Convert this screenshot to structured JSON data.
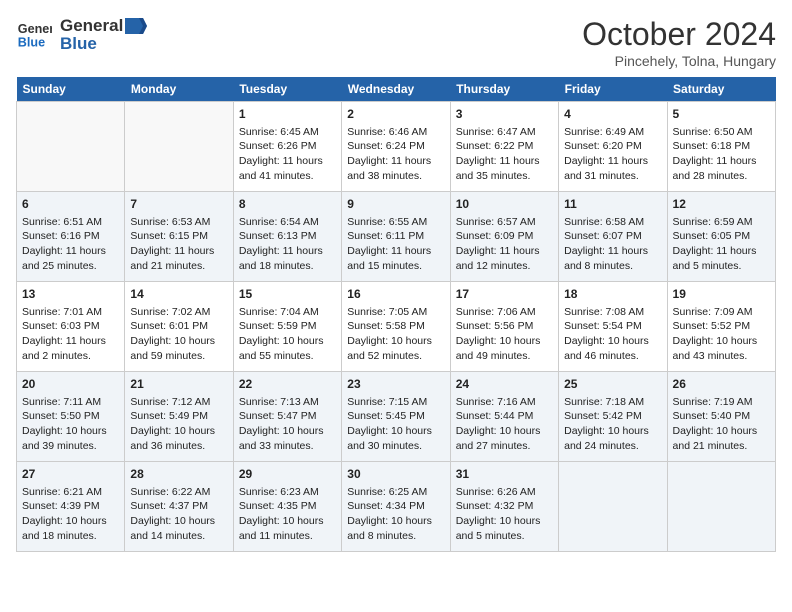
{
  "header": {
    "logo_line1": "General",
    "logo_line2": "Blue",
    "month_title": "October 2024",
    "subtitle": "Pincehely, Tolna, Hungary"
  },
  "weekdays": [
    "Sunday",
    "Monday",
    "Tuesday",
    "Wednesday",
    "Thursday",
    "Friday",
    "Saturday"
  ],
  "weeks": [
    [
      {
        "day": "",
        "content": ""
      },
      {
        "day": "",
        "content": ""
      },
      {
        "day": "1",
        "content": "Sunrise: 6:45 AM\nSunset: 6:26 PM\nDaylight: 11 hours and 41 minutes."
      },
      {
        "day": "2",
        "content": "Sunrise: 6:46 AM\nSunset: 6:24 PM\nDaylight: 11 hours and 38 minutes."
      },
      {
        "day": "3",
        "content": "Sunrise: 6:47 AM\nSunset: 6:22 PM\nDaylight: 11 hours and 35 minutes."
      },
      {
        "day": "4",
        "content": "Sunrise: 6:49 AM\nSunset: 6:20 PM\nDaylight: 11 hours and 31 minutes."
      },
      {
        "day": "5",
        "content": "Sunrise: 6:50 AM\nSunset: 6:18 PM\nDaylight: 11 hours and 28 minutes."
      }
    ],
    [
      {
        "day": "6",
        "content": "Sunrise: 6:51 AM\nSunset: 6:16 PM\nDaylight: 11 hours and 25 minutes."
      },
      {
        "day": "7",
        "content": "Sunrise: 6:53 AM\nSunset: 6:15 PM\nDaylight: 11 hours and 21 minutes."
      },
      {
        "day": "8",
        "content": "Sunrise: 6:54 AM\nSunset: 6:13 PM\nDaylight: 11 hours and 18 minutes."
      },
      {
        "day": "9",
        "content": "Sunrise: 6:55 AM\nSunset: 6:11 PM\nDaylight: 11 hours and 15 minutes."
      },
      {
        "day": "10",
        "content": "Sunrise: 6:57 AM\nSunset: 6:09 PM\nDaylight: 11 hours and 12 minutes."
      },
      {
        "day": "11",
        "content": "Sunrise: 6:58 AM\nSunset: 6:07 PM\nDaylight: 11 hours and 8 minutes."
      },
      {
        "day": "12",
        "content": "Sunrise: 6:59 AM\nSunset: 6:05 PM\nDaylight: 11 hours and 5 minutes."
      }
    ],
    [
      {
        "day": "13",
        "content": "Sunrise: 7:01 AM\nSunset: 6:03 PM\nDaylight: 11 hours and 2 minutes."
      },
      {
        "day": "14",
        "content": "Sunrise: 7:02 AM\nSunset: 6:01 PM\nDaylight: 10 hours and 59 minutes."
      },
      {
        "day": "15",
        "content": "Sunrise: 7:04 AM\nSunset: 5:59 PM\nDaylight: 10 hours and 55 minutes."
      },
      {
        "day": "16",
        "content": "Sunrise: 7:05 AM\nSunset: 5:58 PM\nDaylight: 10 hours and 52 minutes."
      },
      {
        "day": "17",
        "content": "Sunrise: 7:06 AM\nSunset: 5:56 PM\nDaylight: 10 hours and 49 minutes."
      },
      {
        "day": "18",
        "content": "Sunrise: 7:08 AM\nSunset: 5:54 PM\nDaylight: 10 hours and 46 minutes."
      },
      {
        "day": "19",
        "content": "Sunrise: 7:09 AM\nSunset: 5:52 PM\nDaylight: 10 hours and 43 minutes."
      }
    ],
    [
      {
        "day": "20",
        "content": "Sunrise: 7:11 AM\nSunset: 5:50 PM\nDaylight: 10 hours and 39 minutes."
      },
      {
        "day": "21",
        "content": "Sunrise: 7:12 AM\nSunset: 5:49 PM\nDaylight: 10 hours and 36 minutes."
      },
      {
        "day": "22",
        "content": "Sunrise: 7:13 AM\nSunset: 5:47 PM\nDaylight: 10 hours and 33 minutes."
      },
      {
        "day": "23",
        "content": "Sunrise: 7:15 AM\nSunset: 5:45 PM\nDaylight: 10 hours and 30 minutes."
      },
      {
        "day": "24",
        "content": "Sunrise: 7:16 AM\nSunset: 5:44 PM\nDaylight: 10 hours and 27 minutes."
      },
      {
        "day": "25",
        "content": "Sunrise: 7:18 AM\nSunset: 5:42 PM\nDaylight: 10 hours and 24 minutes."
      },
      {
        "day": "26",
        "content": "Sunrise: 7:19 AM\nSunset: 5:40 PM\nDaylight: 10 hours and 21 minutes."
      }
    ],
    [
      {
        "day": "27",
        "content": "Sunrise: 6:21 AM\nSunset: 4:39 PM\nDaylight: 10 hours and 18 minutes."
      },
      {
        "day": "28",
        "content": "Sunrise: 6:22 AM\nSunset: 4:37 PM\nDaylight: 10 hours and 14 minutes."
      },
      {
        "day": "29",
        "content": "Sunrise: 6:23 AM\nSunset: 4:35 PM\nDaylight: 10 hours and 11 minutes."
      },
      {
        "day": "30",
        "content": "Sunrise: 6:25 AM\nSunset: 4:34 PM\nDaylight: 10 hours and 8 minutes."
      },
      {
        "day": "31",
        "content": "Sunrise: 6:26 AM\nSunset: 4:32 PM\nDaylight: 10 hours and 5 minutes."
      },
      {
        "day": "",
        "content": ""
      },
      {
        "day": "",
        "content": ""
      }
    ]
  ]
}
